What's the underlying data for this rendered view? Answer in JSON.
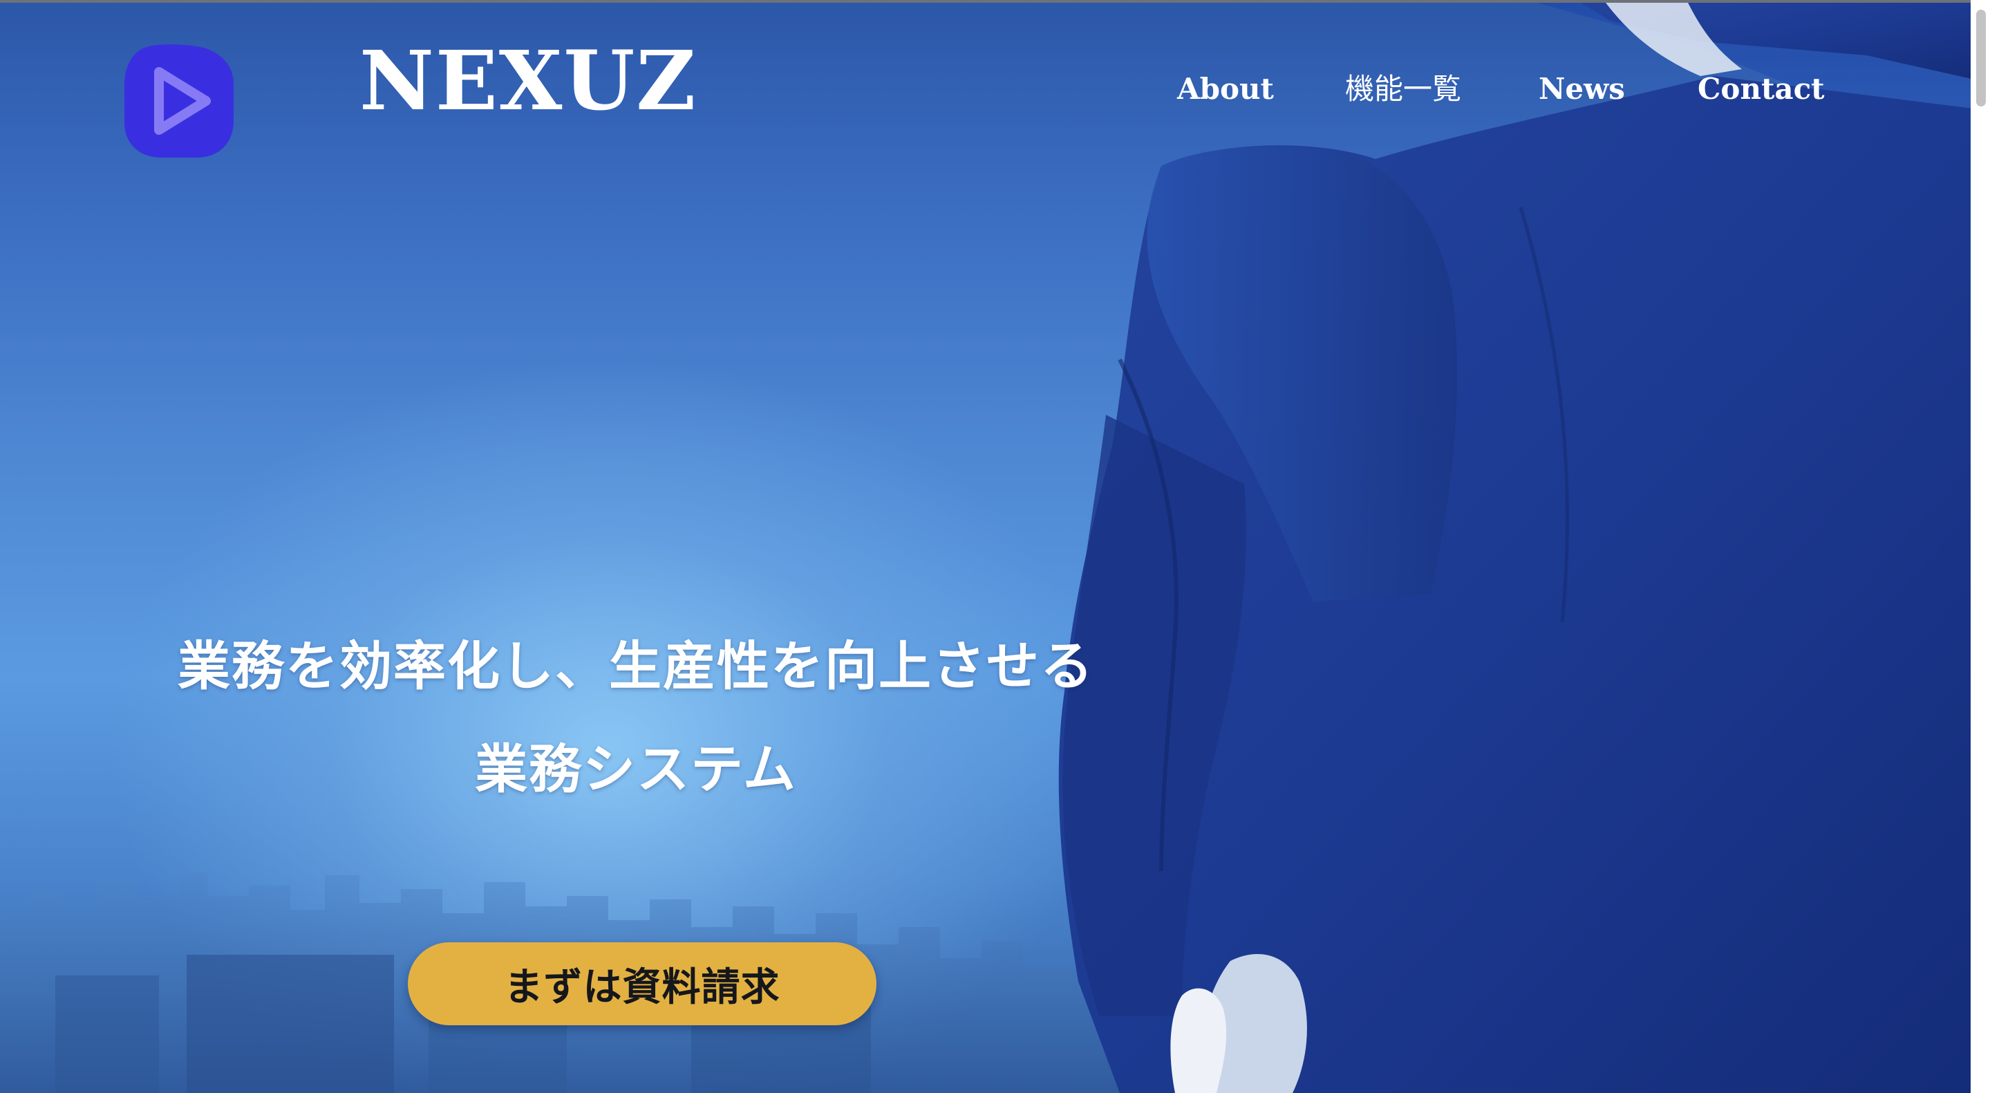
{
  "header": {
    "brand": "NEXUZ",
    "nav": [
      {
        "label": "About"
      },
      {
        "label": "機能一覧"
      },
      {
        "label": "News"
      },
      {
        "label": "Contact"
      }
    ]
  },
  "hero": {
    "headline_line1": "業務を効率化し、生産性を向上させる",
    "headline_line2": "業務システム",
    "cta_label": "まずは資料請求"
  },
  "icons": {
    "logo": "play-logo-icon"
  },
  "colors": {
    "logo_blue": "#3a2fe0",
    "cta_gold": "#e3b142",
    "text_white": "#ffffff",
    "hero_blue": "#4d86d2"
  }
}
